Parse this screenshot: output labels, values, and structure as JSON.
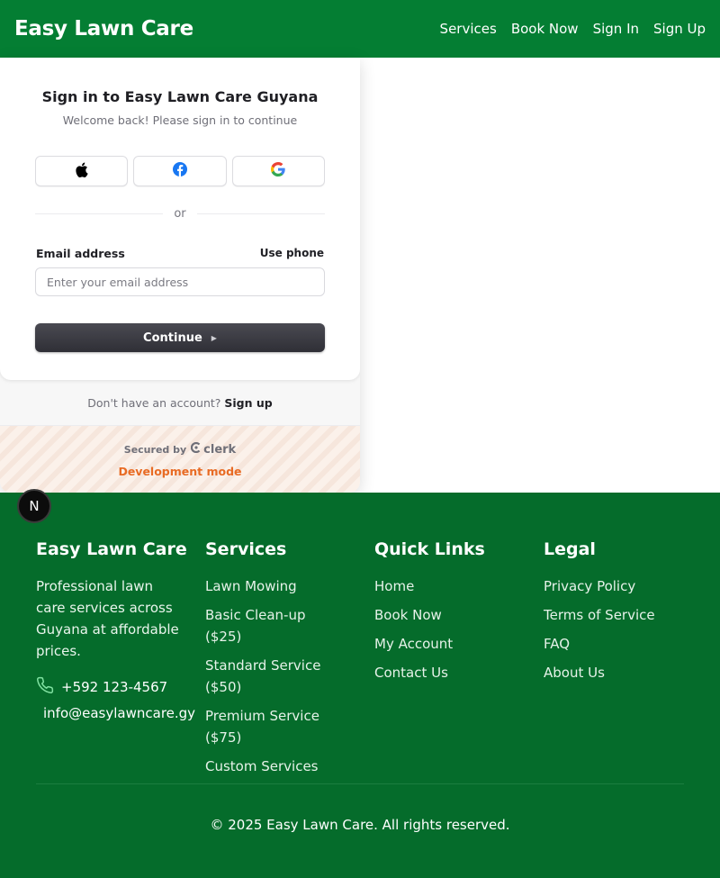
{
  "navbar": {
    "brand": "Easy Lawn Care",
    "links": [
      "Services",
      "Book Now",
      "Sign In",
      "Sign Up"
    ]
  },
  "signin": {
    "title": "Sign in to Easy Lawn Care Guyana",
    "subtitle": "Welcome back! Please sign in to continue",
    "social_icons": [
      "apple-icon",
      "facebook-icon",
      "google-icon"
    ],
    "divider_text": "or",
    "email_label": "Email address",
    "use_phone": "Use phone",
    "email_placeholder": "Enter your email address",
    "continue_label": "Continue",
    "no_account_text": "Don't have an account?",
    "signup_link": "Sign up",
    "secured_by": "Secured by",
    "clerk_label": "clerk",
    "dev_mode": "Development mode"
  },
  "badge": {
    "letter": "N"
  },
  "footer": {
    "about": {
      "heading": "Easy Lawn Care",
      "description": "Professional lawn care services across Guyana at affordable prices.",
      "phone": "+592 123-4567",
      "email": "info@easylawncare.gy"
    },
    "services": {
      "heading": "Services",
      "items": [
        "Lawn Mowing",
        "Basic Clean-up ($25)",
        "Standard Service ($50)",
        "Premium Service ($75)",
        "Custom Services"
      ]
    },
    "quick_links": {
      "heading": "Quick Links",
      "items": [
        "Home",
        "Book Now",
        "My Account",
        "Contact Us"
      ]
    },
    "legal": {
      "heading": "Legal",
      "items": [
        "Privacy Policy",
        "Terms of Service",
        "FAQ",
        "About Us"
      ]
    },
    "copyright": "© 2025 Easy Lawn Care. All rights reserved."
  },
  "colors": {
    "nav_green": "#047e33",
    "footer_green": "#056c2b",
    "dev_orange": "#e86b24",
    "button_dark": "#2f2f36"
  }
}
